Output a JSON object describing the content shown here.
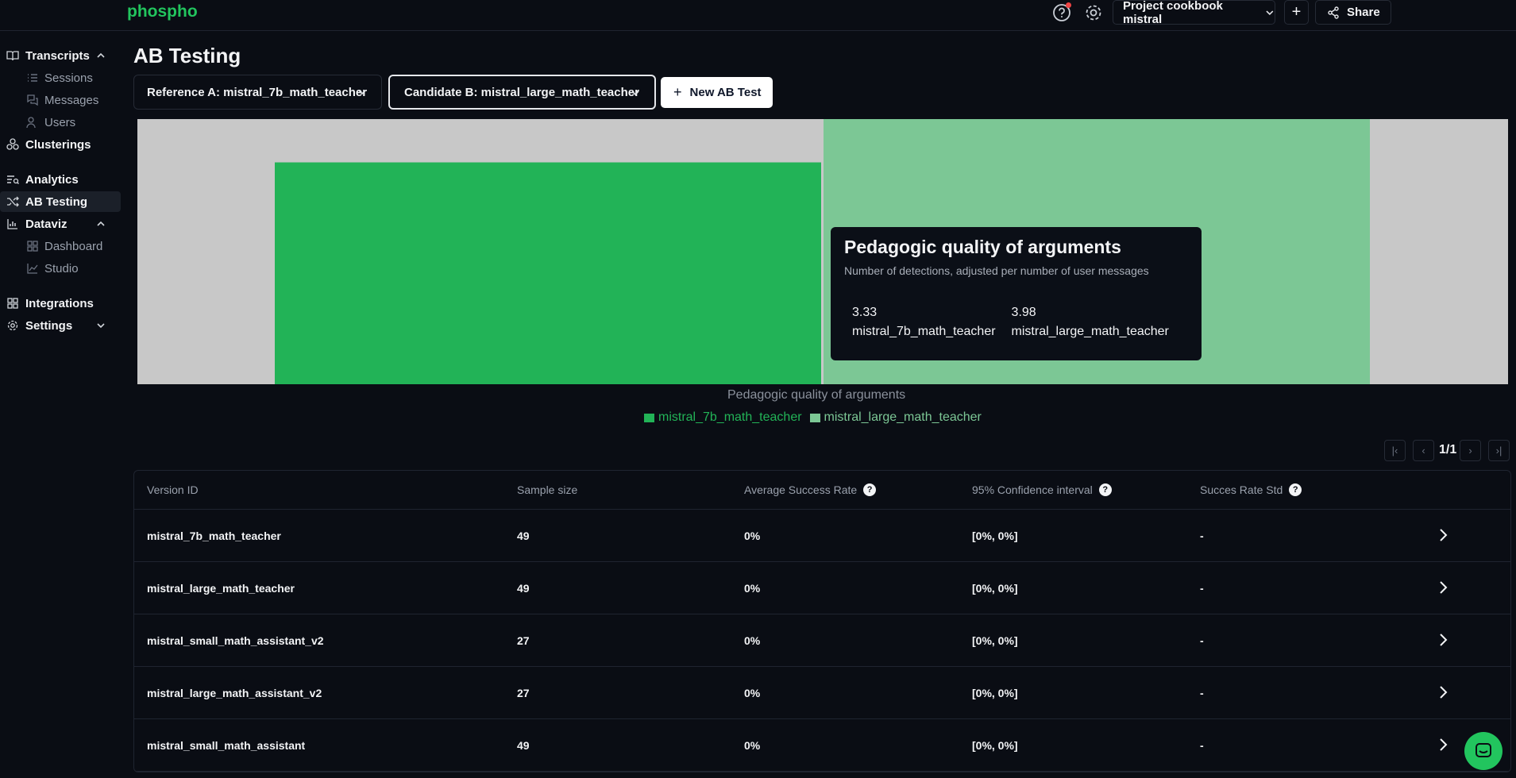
{
  "app": {
    "brand": "phospho"
  },
  "header": {
    "project_label": "Project cookbook mistral",
    "share_label": "Share",
    "add_label": "+"
  },
  "sidebar": {
    "items": [
      {
        "label": "Transcripts",
        "icon": "book-icon",
        "level": "top",
        "expanded": true
      },
      {
        "label": "Sessions",
        "icon": "list-icon",
        "level": "sub"
      },
      {
        "label": "Messages",
        "icon": "messages-icon",
        "level": "sub"
      },
      {
        "label": "Users",
        "icon": "users-icon",
        "level": "sub"
      },
      {
        "label": "Clusterings",
        "icon": "clusters-icon",
        "level": "top"
      },
      {
        "label": "Analytics",
        "icon": "analytics-icon",
        "level": "top"
      },
      {
        "label": "AB Testing",
        "icon": "shuffle-icon",
        "level": "top",
        "active": true
      },
      {
        "label": "Dataviz",
        "icon": "chart-icon",
        "level": "top",
        "expanded": true
      },
      {
        "label": "Dashboard",
        "icon": "grid-icon",
        "level": "sub"
      },
      {
        "label": "Studio",
        "icon": "line-chart-icon",
        "level": "sub"
      },
      {
        "label": "Integrations",
        "icon": "grid-icon",
        "level": "top"
      },
      {
        "label": "Settings",
        "icon": "gear-icon",
        "level": "top",
        "expanded": false
      }
    ]
  },
  "main": {
    "title": "AB Testing",
    "reference_label": "Reference A: mistral_7b_math_teacher",
    "candidate_label": "Candidate B: mistral_large_math_teacher",
    "new_ab_label": "New AB Test"
  },
  "chart_data": {
    "type": "bar",
    "categories": [
      "Pedagogic quality of arguments"
    ],
    "series": [
      {
        "name": "mistral_7b_math_teacher",
        "values": [
          3.33
        ],
        "color": "#22b357"
      },
      {
        "name": "mistral_large_math_teacher",
        "values": [
          3.98
        ],
        "color": "#7cc795"
      }
    ],
    "xlabel": "Pedagogic quality of arguments",
    "ylim": [
      0,
      3.98
    ],
    "legend": "bottom-center",
    "tooltip": {
      "title": "Pedagogic quality of arguments",
      "subtitle": "Number of detections, adjusted per number of user messages",
      "values": [
        "3.33",
        "3.98"
      ],
      "names": [
        "mistral_7b_math_teacher",
        "mistral_large_math_teacher"
      ]
    }
  },
  "pagination": {
    "label": "1/1"
  },
  "table": {
    "headers": [
      "Version ID",
      "Sample size",
      "Average Success Rate",
      "95% Confidence interval",
      "Succes Rate Std"
    ],
    "rows": [
      [
        "mistral_7b_math_teacher",
        "49",
        "0%",
        "[0%, 0%]",
        "-"
      ],
      [
        "mistral_large_math_teacher",
        "49",
        "0%",
        "[0%, 0%]",
        "-"
      ],
      [
        "mistral_small_math_assistant_v2",
        "27",
        "0%",
        "[0%, 0%]",
        "-"
      ],
      [
        "mistral_large_math_assistant_v2",
        "27",
        "0%",
        "[0%, 0%]",
        "-"
      ],
      [
        "mistral_small_math_assistant",
        "49",
        "0%",
        "[0%, 0%]",
        "-"
      ]
    ]
  },
  "colors": {
    "accent": "#22c55e",
    "background": "#0a0d14"
  }
}
